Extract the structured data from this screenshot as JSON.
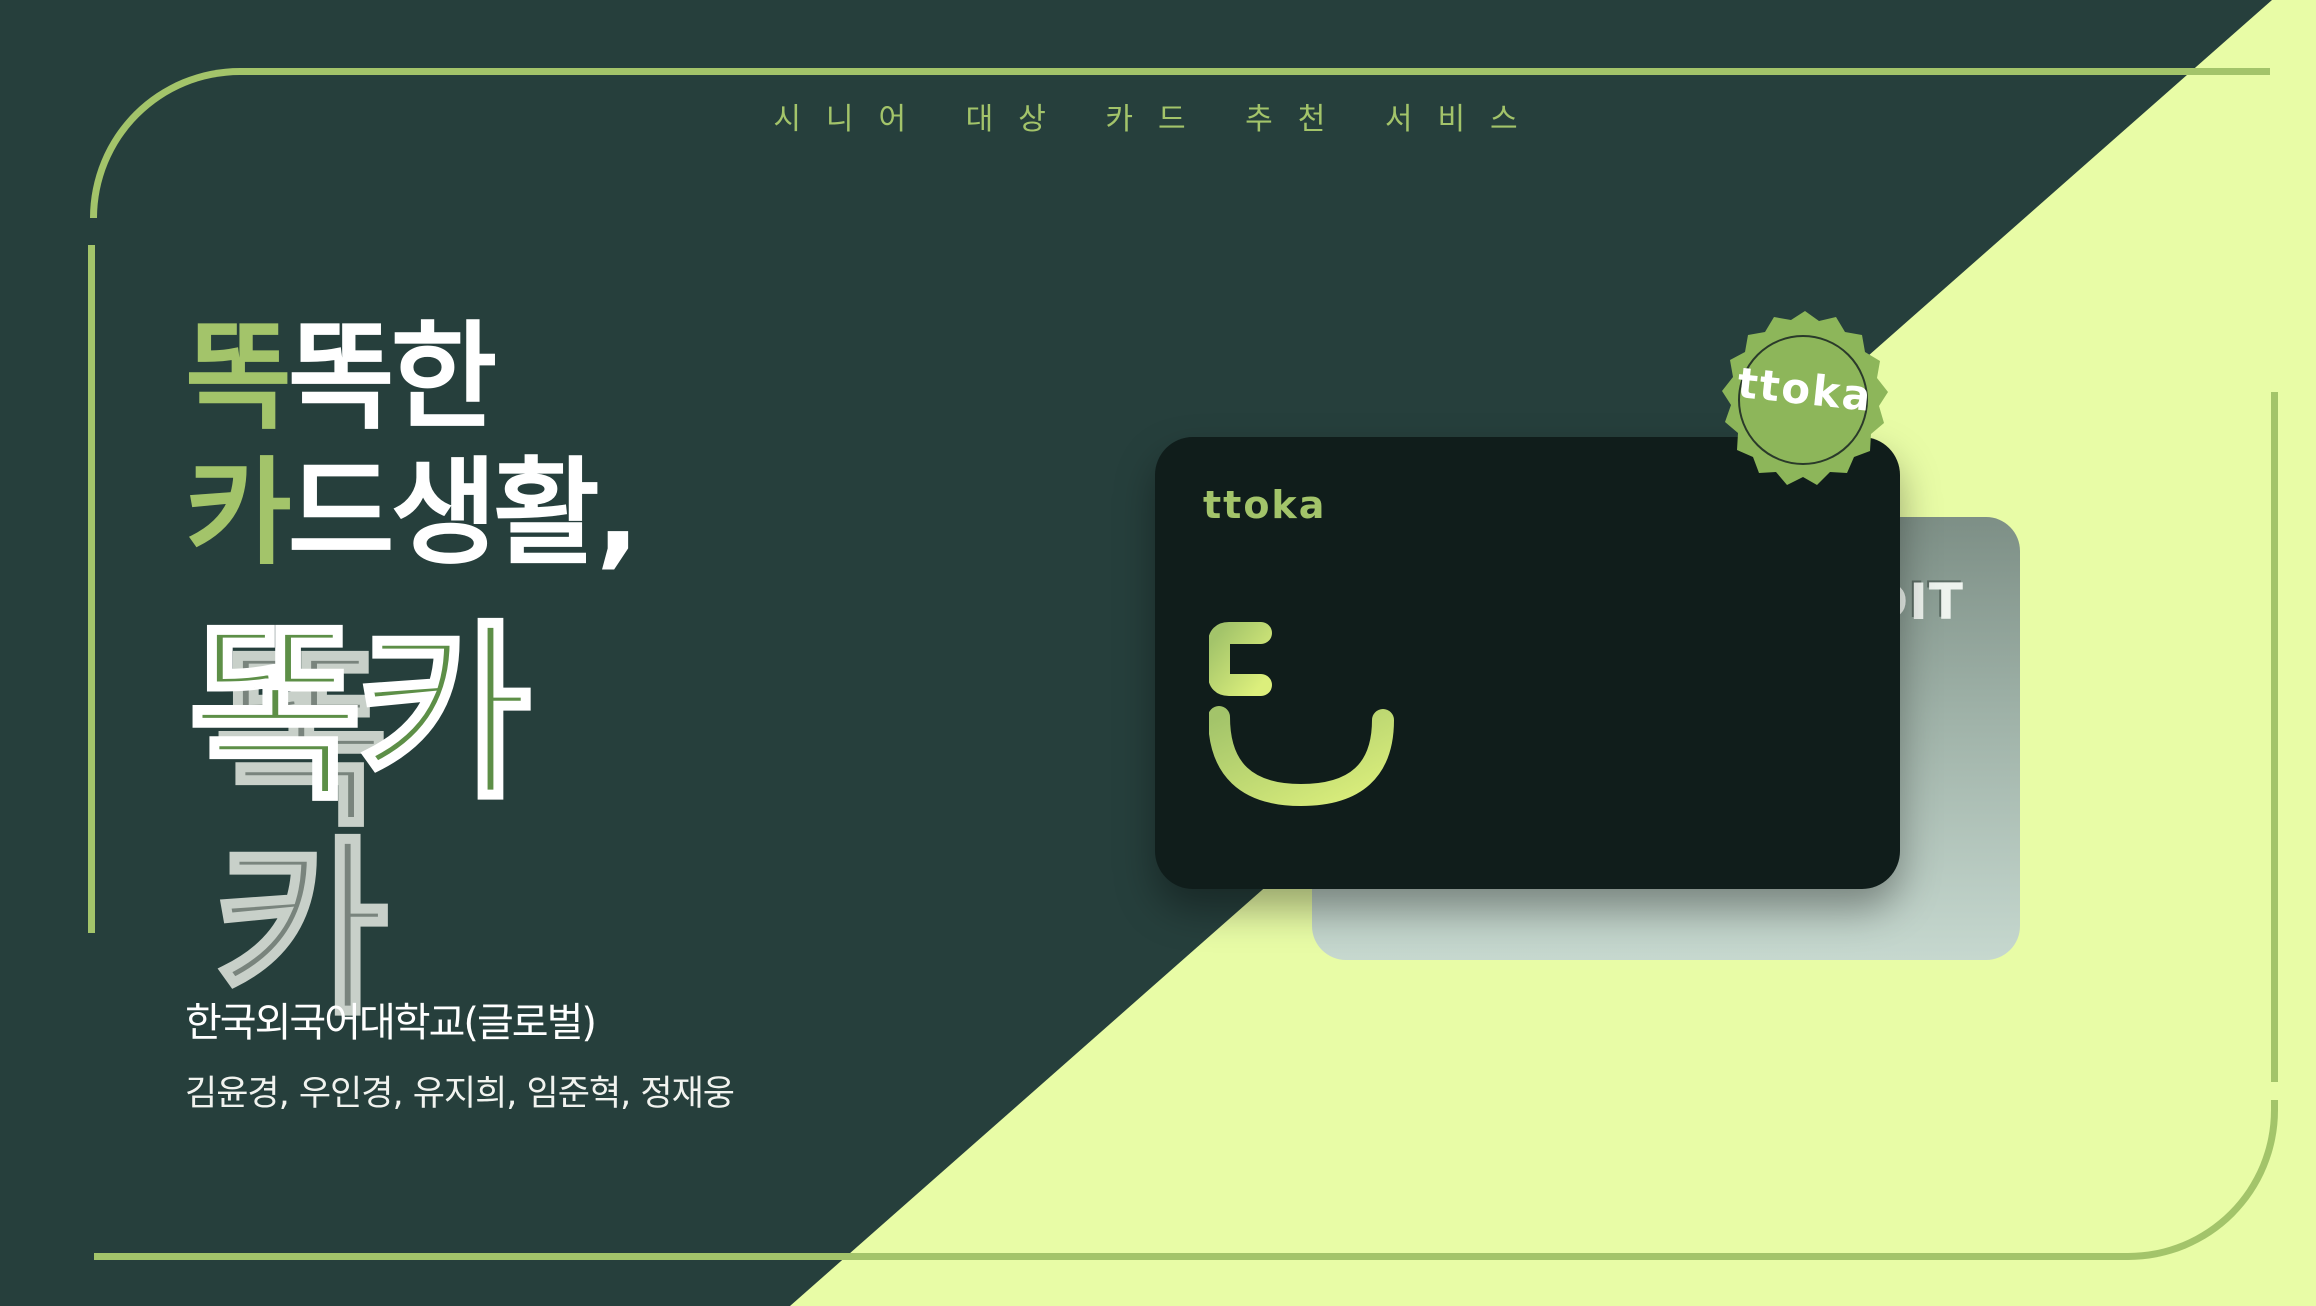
{
  "header": {
    "subtitle": "시니어 대상 카드 추천 서비스"
  },
  "hero": {
    "line1_accent": "똑",
    "line1_rest": "똑한",
    "line2_accent": "카",
    "line2_rest": "드생활,",
    "brand_name": "똑카"
  },
  "credits": {
    "school": "한국외국어대학교(글로벌)",
    "members": "김윤경, 우인경, 유지희, 임준혁, 정재웅"
  },
  "cards": {
    "front_brand": "ttoka",
    "back_text": "DIT",
    "seal_text": "ttoka"
  },
  "colors": {
    "dark_green": "#263f3c",
    "lime": "#e8fca6",
    "accent": "#a3c46a",
    "brand_fill": "#5d8f47"
  },
  "icons": [
    "ttoka-logo-icon",
    "ttoka-seal-badge"
  ]
}
